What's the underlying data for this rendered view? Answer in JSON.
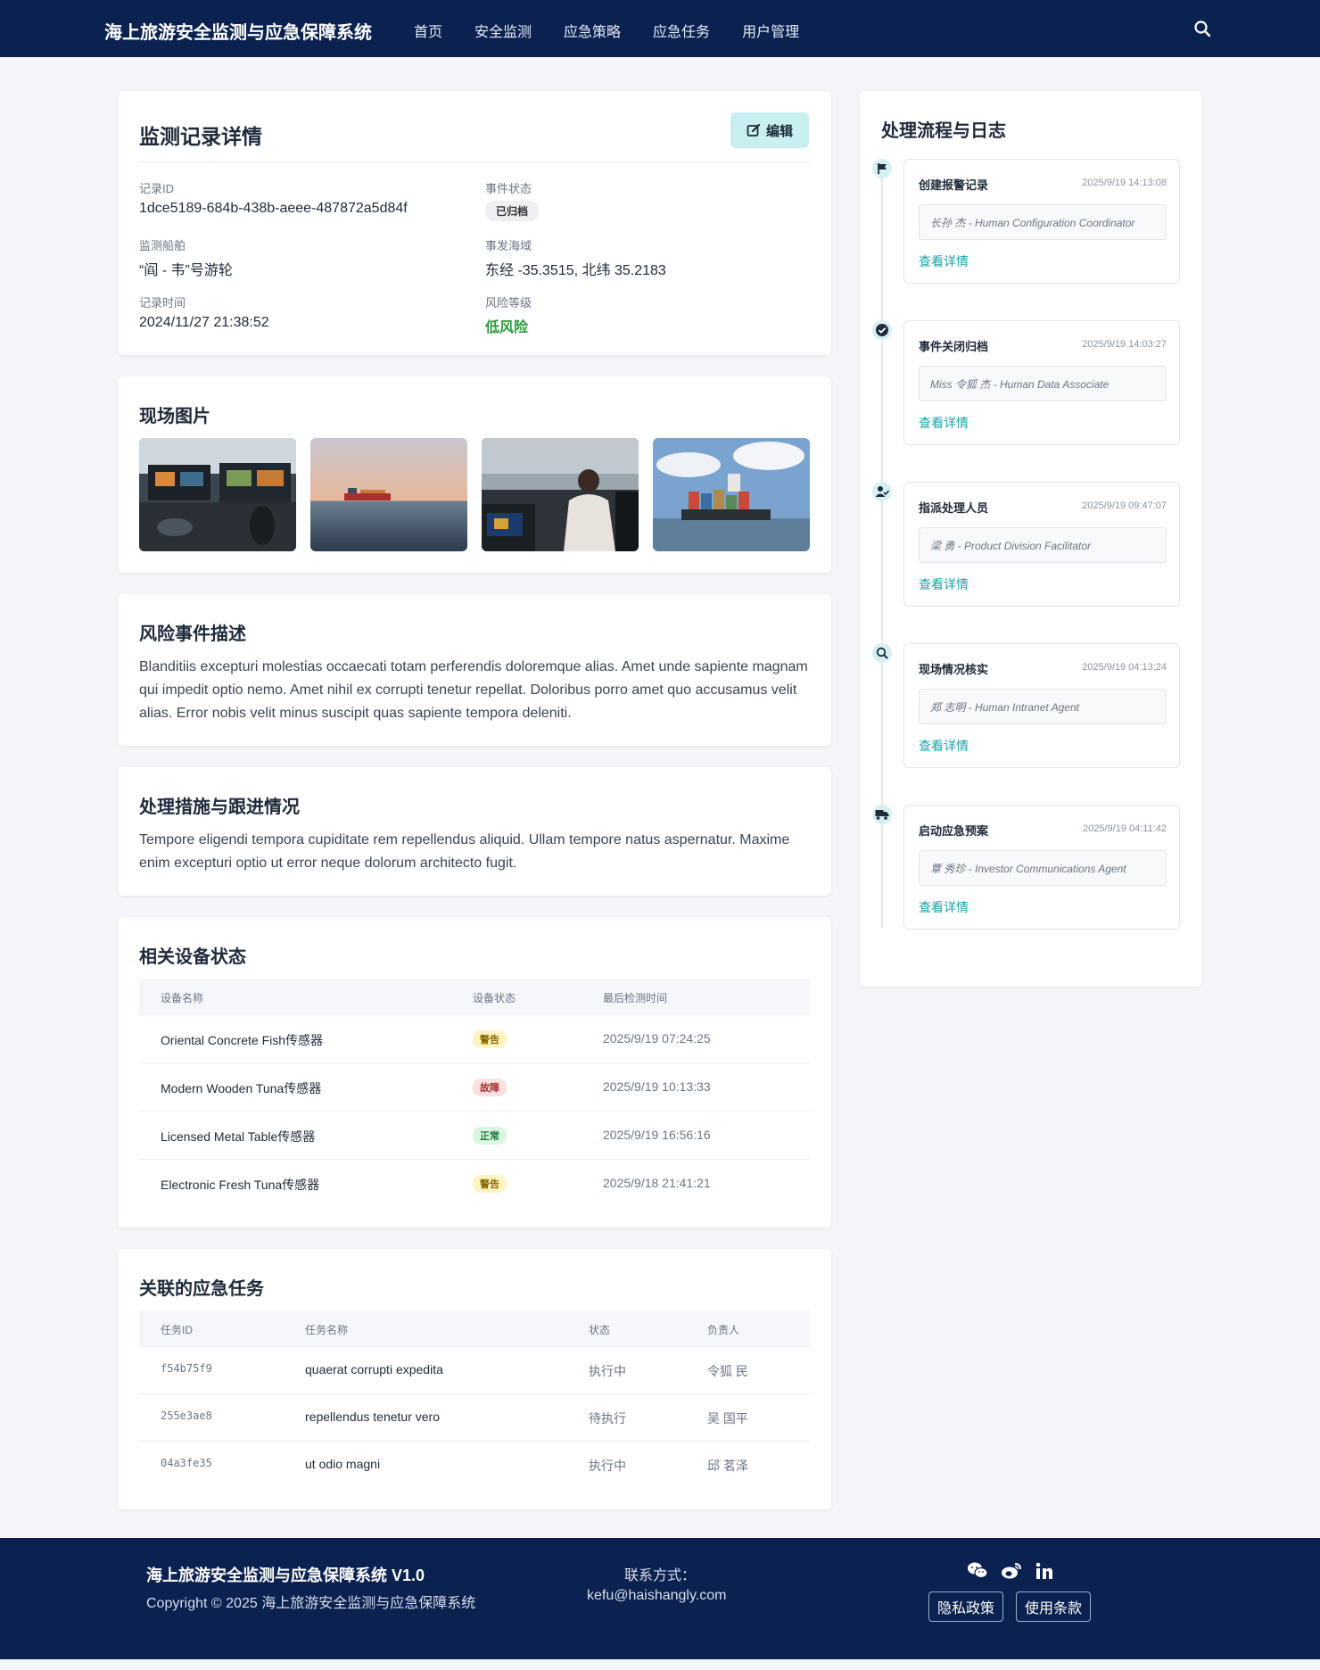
{
  "nav": {
    "brand": "海上旅游安全监测与应急保障系统",
    "links": [
      "首页",
      "安全监测",
      "应急策略",
      "应急任务",
      "用户管理"
    ]
  },
  "detail": {
    "title": "监测记录详情",
    "edit_label": "编辑",
    "fields": {
      "record_id_label": "记录ID",
      "record_id": "1dce5189-684b-438b-aeee-487872a5d84f",
      "status_label": "事件状态",
      "status": "已归档",
      "ship_label": "监测船舶",
      "ship": "“阎 - 韦”号游轮",
      "area_label": "事发海域",
      "area": "东经 -35.3515, 北纬 35.2183",
      "time_label": "记录时间",
      "time": "2024/11/27 21:38:52",
      "risk_label": "风险等级",
      "risk": "低风险"
    }
  },
  "photos": {
    "title": "现场图片",
    "items": [
      "ship-bridge-console-photo",
      "cargo-ship-at-sunset-photo",
      "captain-at-helm-photo",
      "container-ship-photo"
    ]
  },
  "description": {
    "title": "风险事件描述",
    "text": "Blanditiis excepturi molestias occaecati totam perferendis doloremque alias. Amet unde sapiente magnam qui impedit optio nemo. Amet nihil ex corrupti tenetur repellat. Doloribus porro amet quo accusamus velit alias. Error nobis velit minus suscipit quas sapiente tempora deleniti."
  },
  "measures": {
    "title": "处理措施与跟进情况",
    "text": "Tempore eligendi tempora cupiditate rem repellendus aliquid. Ullam tempore natus aspernatur. Maxime enim excepturi optio ut error neque dolorum architecto fugit."
  },
  "devices": {
    "title": "相关设备状态",
    "headers": [
      "设备名称",
      "设备状态",
      "最后检测时间"
    ],
    "rows": [
      {
        "name": "Oriental Concrete Fish传感器",
        "status": "警告",
        "time": "2025/9/19 07:24:25"
      },
      {
        "name": "Modern Wooden Tuna传感器",
        "status": "故障",
        "time": "2025/9/19 10:13:33"
      },
      {
        "name": "Licensed Metal Table传感器",
        "status": "正常",
        "time": "2025/9/19 16:56:16"
      },
      {
        "name": "Electronic Fresh Tuna传感器",
        "status": "警告",
        "time": "2025/9/18 21:41:21"
      }
    ],
    "status_colors": {
      "警告": "#fff4c2",
      "故障": "#fde0e0",
      "正常": "#dcf5e3"
    },
    "status_text_colors": {
      "警告": "#8a6a00",
      "故障": "#b02a2a",
      "正常": "#1e7a3a"
    }
  },
  "tasks": {
    "title": "关联的应急任务",
    "headers": [
      "任务ID",
      "任务名称",
      "状态",
      "负责人"
    ],
    "rows": [
      {
        "id": "f54b75f9",
        "name": "quaerat corrupti expedita",
        "status": "执行中",
        "owner": "令狐 民"
      },
      {
        "id": "255e3ae8",
        "name": "repellendus tenetur vero",
        "status": "待执行",
        "owner": "吴 国平"
      },
      {
        "id": "04a3fe35",
        "name": "ut odio magni",
        "status": "执行中",
        "owner": "邱 茗泽"
      }
    ]
  },
  "timeline": {
    "title": "处理流程与日志",
    "link_label": "查看详情",
    "items": [
      {
        "icon": "flag-icon",
        "title": "创建报警记录",
        "time": "2025/9/19 14:13:08",
        "person": "长孙 杰 - Human Configuration Coordinator"
      },
      {
        "icon": "check-circle-icon",
        "title": "事件关闭归档",
        "time": "2025/9/19 14:03:27",
        "person": "Miss 令狐 杰 - Human Data Associate"
      },
      {
        "icon": "user-check-icon",
        "title": "指派处理人员",
        "time": "2025/9/19 09:47:07",
        "person": "梁 勇 - Product Division Facilitator"
      },
      {
        "icon": "search-icon",
        "title": "现场情况核实",
        "time": "2025/9/19 04:13:24",
        "person": "郑 志明 - Human Intranet Agent"
      },
      {
        "icon": "truck-icon",
        "title": "启动应急预案",
        "time": "2025/9/19 04:11:42",
        "person": "覃 秀珍 - Investor Communications Agent"
      }
    ]
  },
  "footer": {
    "title": "海上旅游安全监测与应急保障系统 V1.0",
    "copyright": "Copyright © 2025 海上旅游安全监测与应急保障系统",
    "contact_label": "联系方式：",
    "email": "kefu@haishangly.com",
    "privacy": "隐私政策",
    "terms": "使用条款",
    "social_icons": [
      "wechat-icon",
      "weibo-icon",
      "linkedin-icon"
    ]
  }
}
